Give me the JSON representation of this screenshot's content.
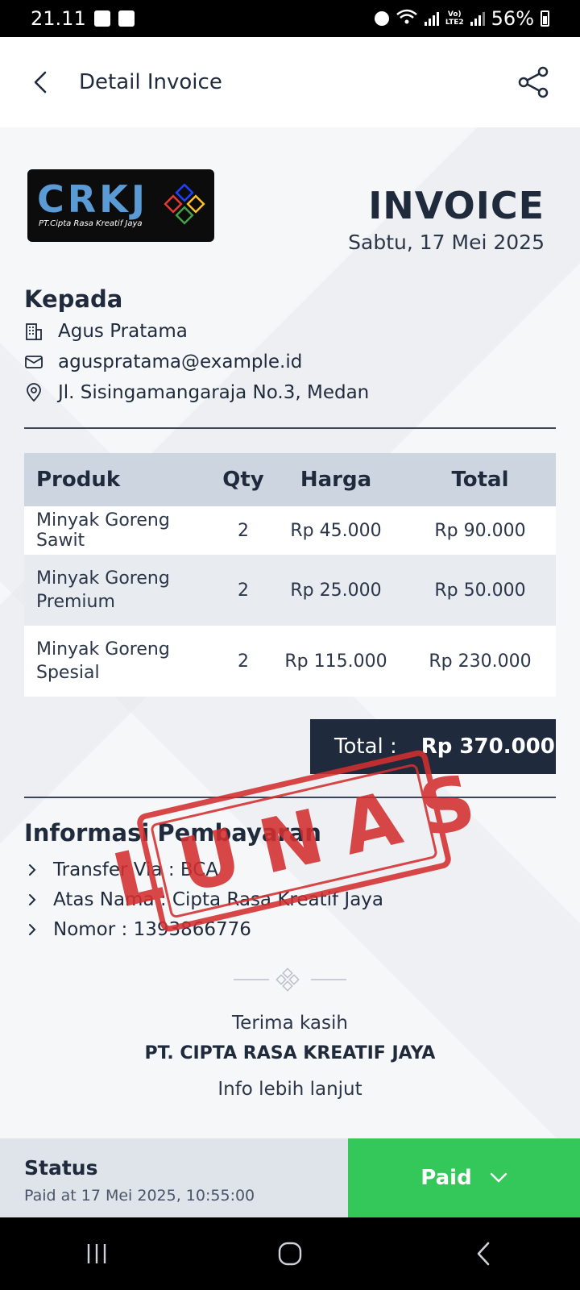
{
  "status_bar": {
    "time": "21.11",
    "network_label": "LTE2",
    "volte_label": "Vo)",
    "battery": "56%"
  },
  "appbar": {
    "title": "Detail Invoice",
    "back_icon": "chevron-left-icon",
    "share_icon": "share-icon"
  },
  "header": {
    "logo_text": "CRKJ",
    "logo_subtitle": "PT.Cipta Rasa Kreatif Jaya",
    "document_title": "INVOICE",
    "date": "Sabtu, 17 Mei 2025"
  },
  "recipient": {
    "heading": "Kepada",
    "name": "Agus Pratama",
    "email": "aguspratama@example.id",
    "address": "Jl. Sisingamangaraja No.3, Medan"
  },
  "items_table": {
    "columns": [
      "Produk",
      "Qty",
      "Harga",
      "Total"
    ],
    "rows": [
      {
        "produk": "Minyak Goreng Sawit",
        "qty": "2",
        "harga": "Rp 45.000",
        "total": "Rp 90.000"
      },
      {
        "produk": "Minyak Goreng Premium",
        "qty": "2",
        "harga": "Rp 25.000",
        "total": "Rp 50.000"
      },
      {
        "produk": "Minyak Goreng Spesial",
        "qty": "2",
        "harga": "Rp 115.000",
        "total": "Rp 230.000"
      }
    ]
  },
  "total": {
    "label": "Total :",
    "value": "Rp 370.000"
  },
  "stamp": {
    "text": "LUNAS",
    "color": "#d32f2f"
  },
  "payment_info": {
    "heading": "Informasi Pembayaran",
    "items": [
      "Transfer Via : BCA",
      "Atas Nama : Cipta Rasa Kreatif Jaya",
      "Nomor : 1393866776"
    ]
  },
  "footer": {
    "thanks": "Terima kasih",
    "company": "PT. CIPTA RASA KREATIF JAYA",
    "more_info": "Info lebih lanjut"
  },
  "status_panel": {
    "label": "Status",
    "time": "Paid at 17 Mei 2025, 10:55:00",
    "button_label": "Paid",
    "button_color": "#34c759"
  },
  "colors": {
    "primary_dark": "#1f2a3c",
    "table_header": "#cdd5e0",
    "accent_red": "#d32f2f",
    "accent_green": "#34c759"
  }
}
